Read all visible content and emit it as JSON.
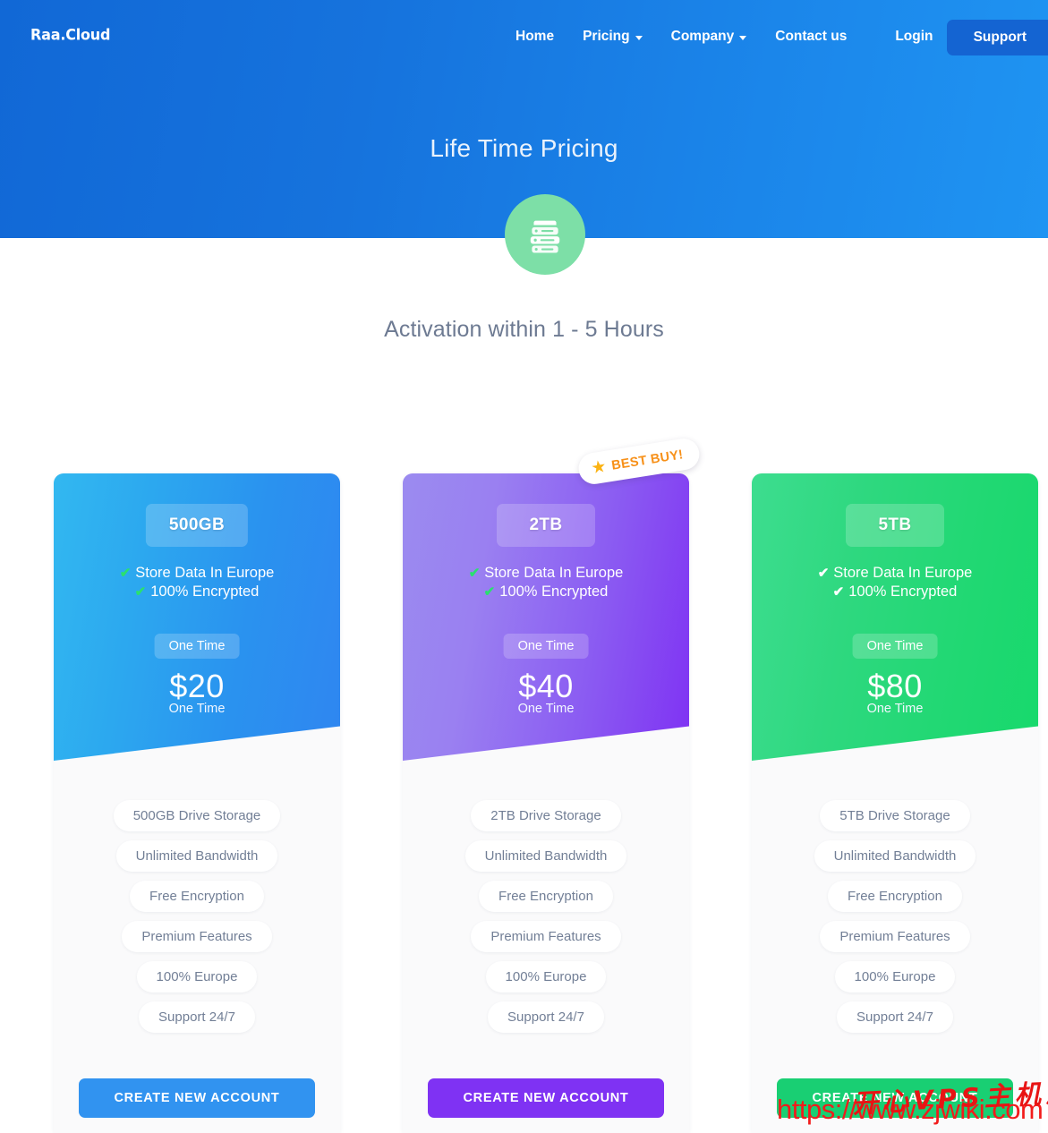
{
  "header": {
    "logo": "Raa.Cloud",
    "nav": [
      {
        "label": "Home",
        "caret": false
      },
      {
        "label": "Pricing",
        "caret": true
      },
      {
        "label": "Company",
        "caret": true
      },
      {
        "label": "Contact us",
        "caret": false
      }
    ],
    "login": "Login",
    "support": "Support",
    "bg_color": "#1673dd"
  },
  "hero": {
    "title": "Life Time Pricing",
    "icon": "server-icon",
    "icon_bg": "#7ddfa7"
  },
  "subtitle": "Activation within 1 - 5 Hours",
  "plans": [
    {
      "name": "500GB",
      "theme": "blue",
      "accent": "#3193f0",
      "highlights": [
        {
          "text": "Store Data In Europe",
          "tick": "check-icon"
        },
        {
          "text": "100% Encrypted",
          "tick": "check-icon"
        }
      ],
      "billing_pill": "One Time",
      "price": "$20",
      "price_note": "One Time",
      "badge": null,
      "features": [
        "500GB Drive Storage",
        "Unlimited Bandwidth",
        "Free Encryption",
        "Premium Features",
        "100% Europe",
        "Support 24/7"
      ],
      "cta": "CREATE NEW ACCOUNT"
    },
    {
      "name": "2TB",
      "theme": "purple",
      "accent": "#7f32f3",
      "highlights": [
        {
          "text": "Store Data In Europe",
          "tick": "check-icon"
        },
        {
          "text": "100% Encrypted",
          "tick": "check-icon"
        }
      ],
      "billing_pill": "One Time",
      "price": "$40",
      "price_note": "One Time",
      "badge": {
        "star": "★",
        "label": "BEST BUY!",
        "color": "#f79018"
      },
      "features": [
        "2TB Drive Storage",
        "Unlimited Bandwidth",
        "Free Encryption",
        "Premium Features",
        "100% Europe",
        "Support 24/7"
      ],
      "cta": "CREATE NEW ACCOUNT"
    },
    {
      "name": "5TB",
      "theme": "green",
      "accent": "#19cf73",
      "highlights": [
        {
          "text": "Store Data In Europe",
          "tick": "check-icon"
        },
        {
          "text": "100% Encrypted",
          "tick": "check-icon"
        }
      ],
      "billing_pill": "One Time",
      "price": "$80",
      "price_note": "One Time",
      "badge": null,
      "features": [
        "5TB Drive Storage",
        "Unlimited Bandwidth",
        "Free Encryption",
        "Premium Features",
        "100% Europe",
        "Support 24/7"
      ],
      "cta": "CREATE NEW ACCOUNT"
    }
  ],
  "watermark": {
    "url": "https://www.zjwiki.com",
    "cn": "开心VPS主机测评",
    "color": "#f21b1b"
  }
}
